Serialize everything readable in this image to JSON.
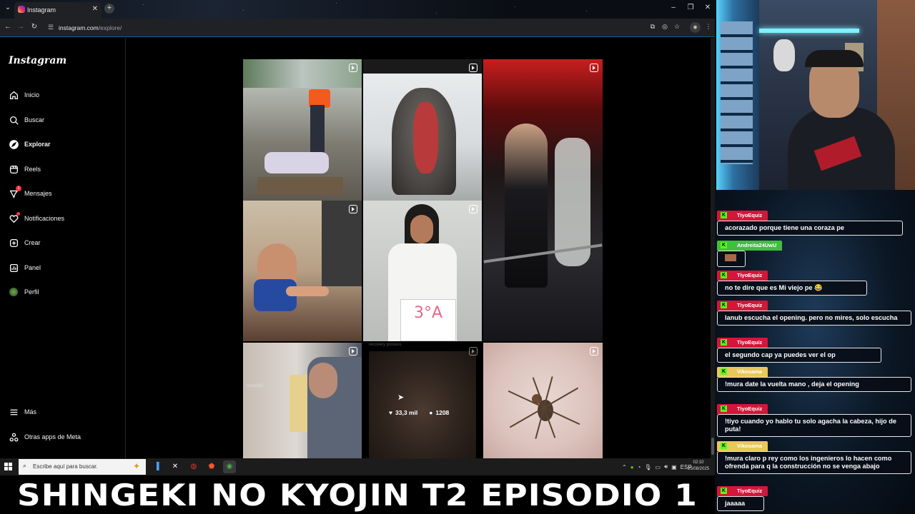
{
  "browser": {
    "tab_title": "Instagram",
    "url_host": "instagram.com",
    "url_path": "/explore/"
  },
  "instagram": {
    "logo": "Instagram",
    "nav": [
      {
        "label": "Inicio",
        "icon": "home-icon"
      },
      {
        "label": "Buscar",
        "icon": "search-icon"
      },
      {
        "label": "Explorar",
        "icon": "compass-icon"
      },
      {
        "label": "Reels",
        "icon": "reels-icon"
      },
      {
        "label": "Mensajes",
        "icon": "messenger-icon",
        "badge": "1"
      },
      {
        "label": "Notificaciones",
        "icon": "heart-icon"
      },
      {
        "label": "Crear",
        "icon": "plus-square-icon"
      },
      {
        "label": "Panel",
        "icon": "chart-icon"
      },
      {
        "label": "Perfil",
        "icon": "profile-avatar-icon"
      }
    ],
    "more_label": "Más",
    "meta_label": "Otras apps de Meta",
    "tiles": {
      "t8_label": "recovery process",
      "t7_label": "Insta360",
      "t5_sign": "3°A",
      "likes": "33,3 mil",
      "comments": "1208"
    }
  },
  "taskbar": {
    "search_placeholder": "Escribe aquí para buscar.",
    "lang": "ESP",
    "time": "02:10",
    "date": "25/08/2025"
  },
  "chat": {
    "messages": [
      {
        "user": "TiyoEquiz",
        "text": "acorazado porque tiene una coraza pe",
        "color": "#d4163a"
      },
      {
        "user": "Andreita24UwU",
        "text": "",
        "color": "#3fbf3f"
      },
      {
        "user": "TiyoEquiz",
        "text": "no te dire que es Mi viejo pe 😂",
        "color": "#d4163a"
      },
      {
        "user": "TiyoEquiz",
        "text": "lanub escucha el opening. pero no mires, solo escucha",
        "color": "#d4163a"
      },
      {
        "user": "TiyoEquiz",
        "text": "el segundo cap ya puedes ver el op",
        "color": "#d4163a"
      },
      {
        "user": "Vikosama",
        "text": "!mura date la vuelta mano , deja el opening",
        "color": "#e9c75a"
      },
      {
        "user": "TiyoEquiz",
        "text": "!tiyo cuando yo hablo tu solo agacha la cabeza, hijo de puta!",
        "color": "#d4163a"
      },
      {
        "user": "Vikosama",
        "text": "!mura claro p rey como los ingenieros lo hacen como ofrenda para q la construcción no se venga abajo",
        "color": "#e9c75a"
      },
      {
        "user": "TiyoEquiz",
        "text": "jaaaaa",
        "color": "#d4163a"
      }
    ]
  },
  "stream_title": "SHINGEKI NO KYOJIN T2 EPISODIO 1"
}
